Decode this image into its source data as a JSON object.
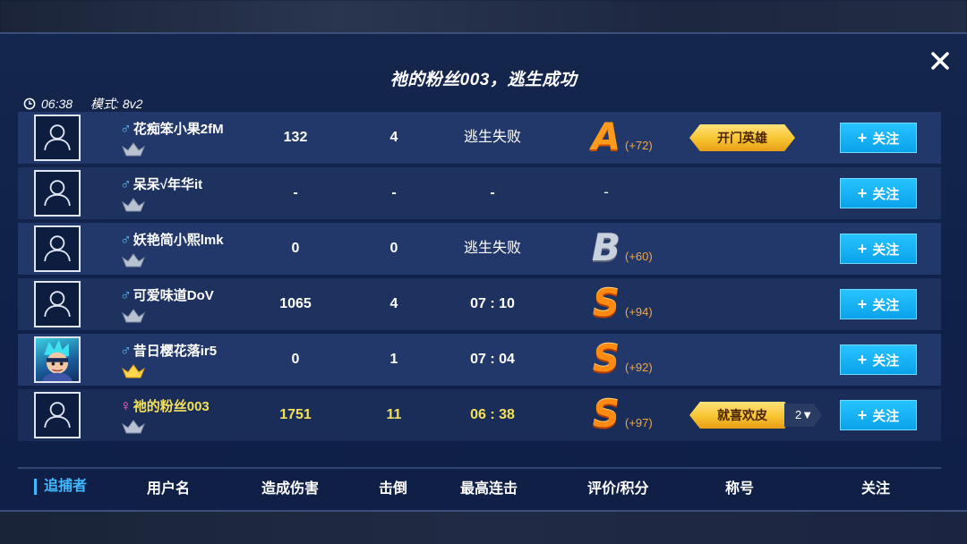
{
  "title": "祂的粉丝003，逃生成功",
  "meta": {
    "time": "06:38",
    "mode": "模式: 8v2"
  },
  "colors": {
    "accent": "#0aa3ea",
    "self_highlight": "#f3e05a",
    "grade_orange": "#ff8a12"
  },
  "rows": [
    {
      "gender": "♂",
      "name": "花痴笨小果2fM",
      "damage": "132",
      "knockdowns": "4",
      "streak": "逃生失败",
      "grade": "A",
      "points": "(+72)",
      "title": "开门英雄",
      "title_count": "",
      "follow": "关注",
      "avatar": "default-avatar-icon",
      "rank": "silver"
    },
    {
      "gender": "♂",
      "name": "呆呆√年华it",
      "damage": "-",
      "knockdowns": "-",
      "streak": "-",
      "grade": "-",
      "points": "",
      "title": "",
      "title_count": "",
      "follow": "关注",
      "avatar": "default-avatar-icon",
      "rank": "silver"
    },
    {
      "gender": "♂",
      "name": "妖艳简小熙lmk",
      "damage": "0",
      "knockdowns": "0",
      "streak": "逃生失败",
      "grade": "B",
      "points": "(+60)",
      "title": "",
      "title_count": "",
      "follow": "关注",
      "avatar": "default-avatar-icon",
      "rank": "silver"
    },
    {
      "gender": "♂",
      "name": "可爱味道DoV",
      "damage": "1065",
      "knockdowns": "4",
      "streak": "07 : 10",
      "grade": "S",
      "points": "(+94)",
      "title": "",
      "title_count": "",
      "follow": "关注",
      "avatar": "default-avatar-icon",
      "rank": "silver"
    },
    {
      "gender": "♂",
      "name": "昔日樱花落ir5",
      "damage": "0",
      "knockdowns": "1",
      "streak": "07 : 04",
      "grade": "S",
      "points": "(+92)",
      "title": "",
      "title_count": "",
      "follow": "关注",
      "avatar": "hero-avatar",
      "rank": "gold"
    },
    {
      "gender": "♀",
      "name": "祂的粉丝003",
      "damage": "1751",
      "knockdowns": "11",
      "streak": "06 : 38",
      "grade": "S",
      "points": "(+97)",
      "title": "就喜欢皮",
      "title_count": "2▼",
      "follow": "关注",
      "avatar": "default-avatar-icon",
      "rank": "silver"
    }
  ],
  "footer": {
    "hunter": "追捕者",
    "username": "用户名",
    "damage": "造成伤害",
    "knockdowns": "击倒",
    "streak": "最高连击",
    "grade": "评价/积分",
    "title": "称号",
    "follow": "关注"
  }
}
